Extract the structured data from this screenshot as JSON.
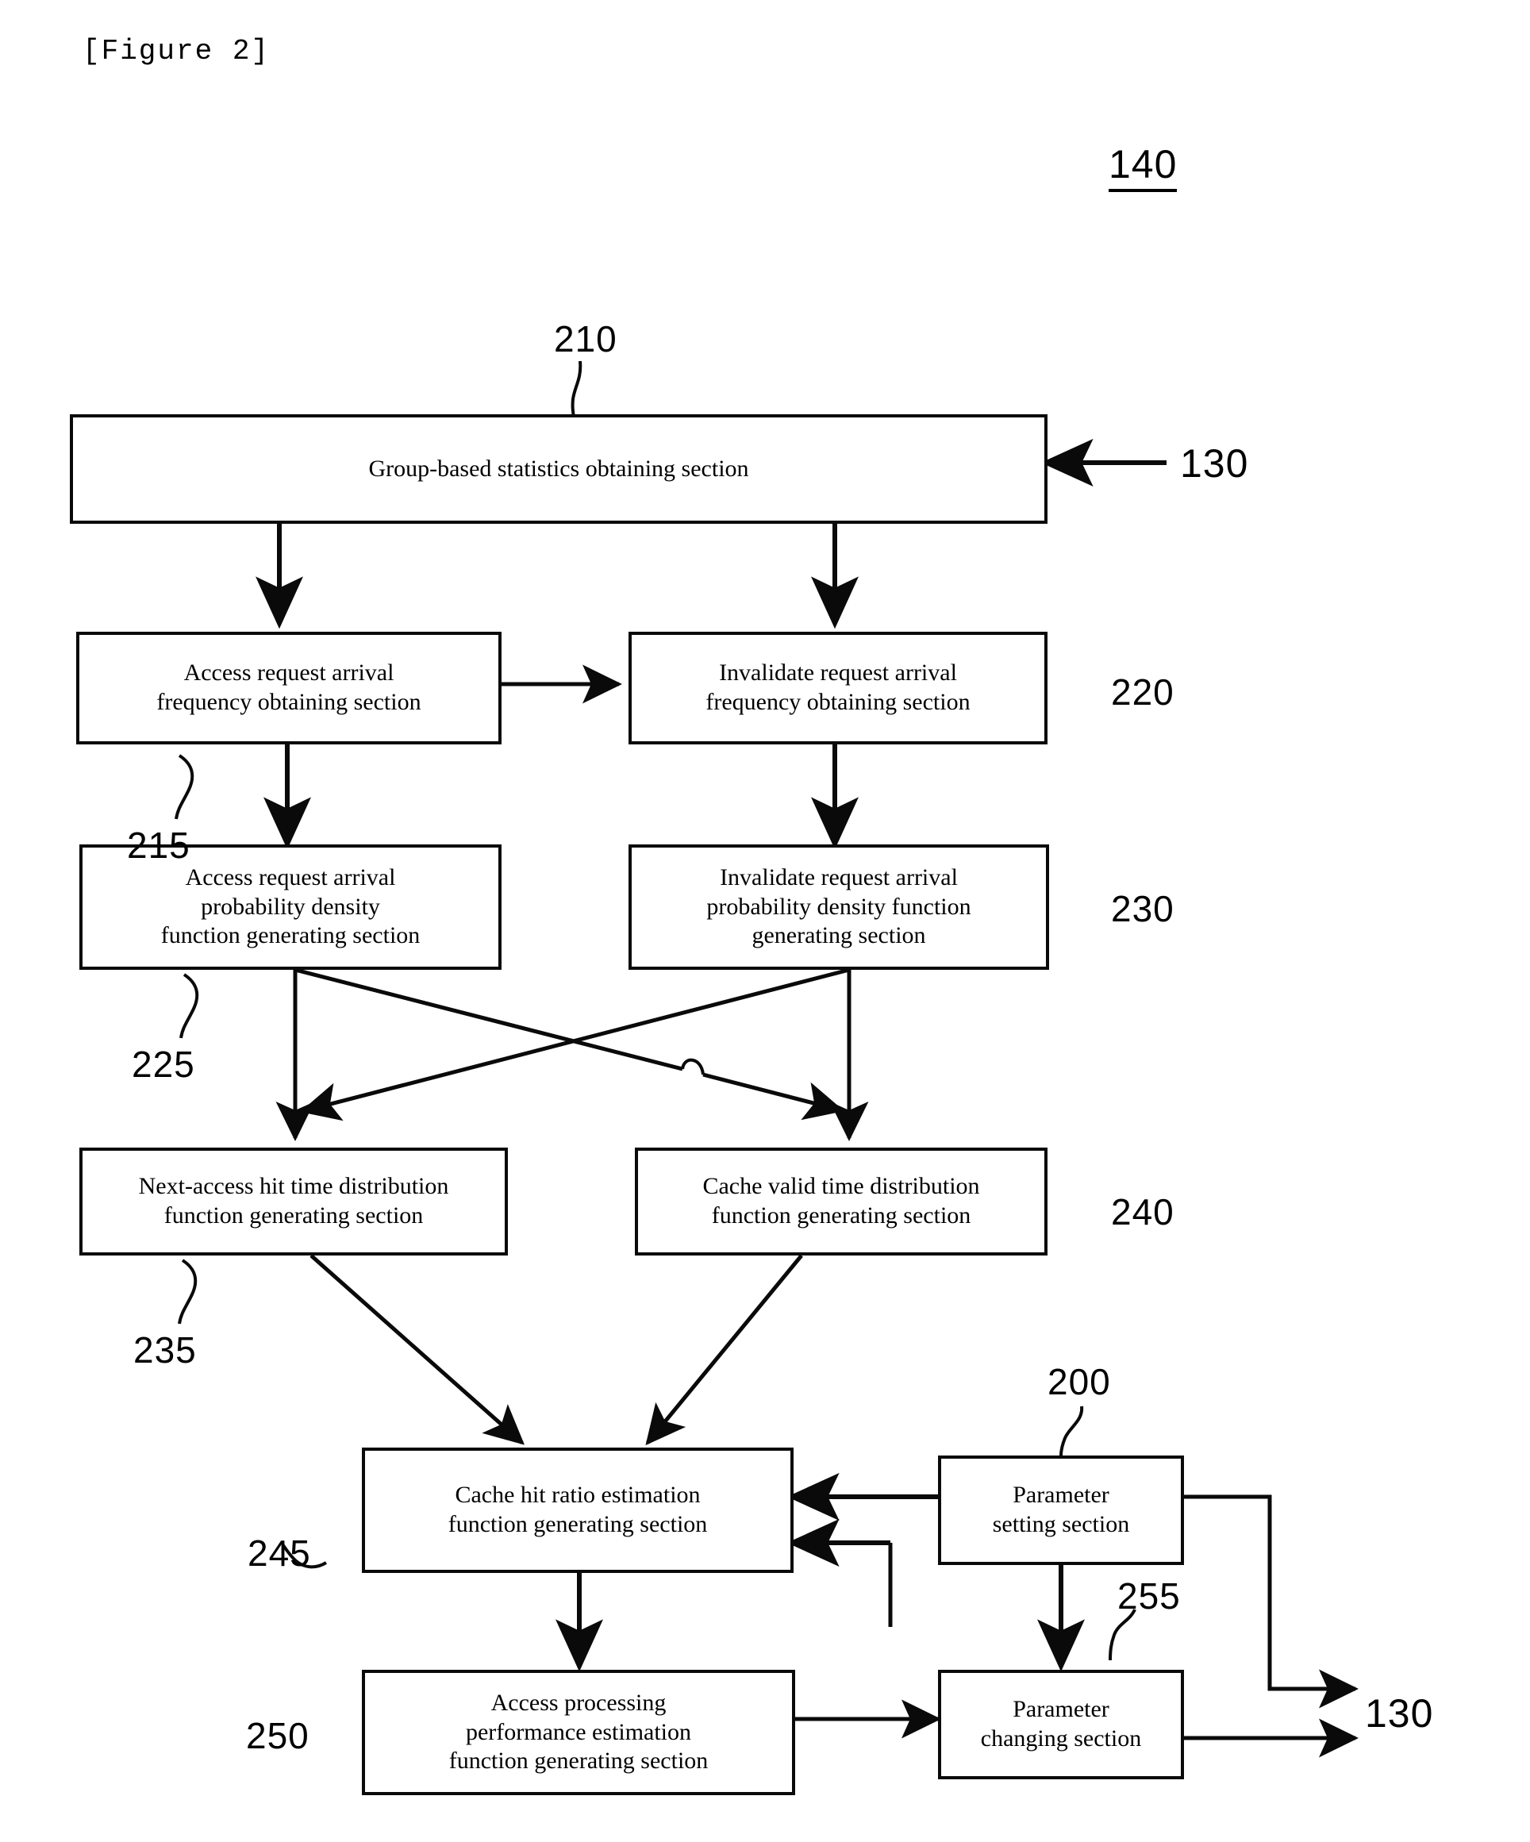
{
  "figure": {
    "title": "[Figure 2]",
    "system_ref": "140"
  },
  "nodes": {
    "group_stats": {
      "label": "Group-based statistics obtaining section",
      "ref": "210"
    },
    "access_freq": {
      "label": "Access request arrival\nfrequency obtaining section",
      "ref": "215"
    },
    "invalidate_freq": {
      "label": "Invalidate request arrival\nfrequency obtaining section",
      "ref": "220"
    },
    "access_pdf": {
      "label": "Access request arrival\nprobability density\nfunction generating section",
      "ref": "225"
    },
    "invalidate_pdf": {
      "label": "Invalidate request arrival\nprobability density function\ngenerating section",
      "ref": "230"
    },
    "next_access_hit": {
      "label": "Next-access hit time distribution\nfunction generating section",
      "ref": "235"
    },
    "cache_valid": {
      "label": "Cache valid time distribution\nfunction generating section",
      "ref": "240"
    },
    "cache_hit_ratio": {
      "label": "Cache hit ratio estimation\nfunction generating section",
      "ref": "245"
    },
    "access_perf": {
      "label": "Access processing\nperformance estimation\nfunction generating section",
      "ref": "250"
    },
    "param_setting": {
      "label": "Parameter\nsetting section",
      "ref": "200"
    },
    "param_changing": {
      "label": "Parameter\nchanging section",
      "ref": "255"
    }
  },
  "external_refs": {
    "input_130": "130",
    "output_130": "130"
  }
}
